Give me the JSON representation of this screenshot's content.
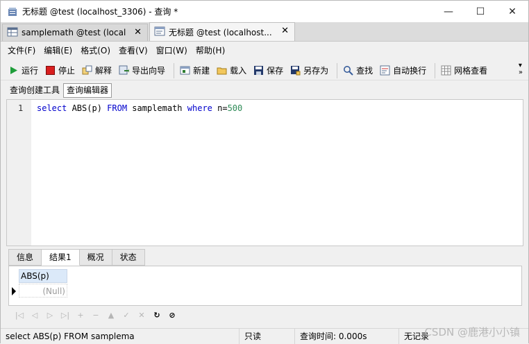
{
  "window": {
    "title": "无标题 @test (localhost_3306) - 查询 *",
    "minimize": "—",
    "maximize": "☐",
    "close": "✕"
  },
  "doc_tabs": [
    {
      "label": "samplemath @test (local...",
      "close": "✕"
    },
    {
      "label": "无标题 @test (localhost...",
      "close": "✕"
    }
  ],
  "menu": [
    "文件(F)",
    "编辑(E)",
    "格式(O)",
    "查看(V)",
    "窗口(W)",
    "帮助(H)"
  ],
  "toolbar": {
    "run": "运行",
    "stop": "停止",
    "explain": "解释",
    "export_wizard": "导出向导",
    "new": "新建",
    "load": "载入",
    "save": "保存",
    "save_as": "另存为",
    "find": "查找",
    "word_wrap": "自动换行",
    "grid_view": "网格查看",
    "more": "»"
  },
  "mode_tabs": [
    "查询创建工具",
    "查询编辑器"
  ],
  "editor": {
    "line_number": "1",
    "kw_select": "select",
    "t_func": " ABS(p) ",
    "kw_from": "FROM",
    "t_table": " samplemath ",
    "kw_where": "where",
    "t_cond": " n=",
    "num_val": "500"
  },
  "result_tabs": [
    "信息",
    "结果1",
    "概况",
    "状态"
  ],
  "grid": {
    "column": "ABS(p)",
    "cell": "(Null)"
  },
  "status": {
    "sql": "select ABS(p) FROM samplema",
    "mode": "只读",
    "query_time": "查询时间: 0.000s",
    "records": "无记录"
  },
  "watermark": "CSDN @鹿港小小镇",
  "colors": {
    "run_green": "#1f9d3a",
    "stop_red": "#d81e1e",
    "keyword_blue": "#0000cc",
    "number_green": "#2e8b57"
  }
}
